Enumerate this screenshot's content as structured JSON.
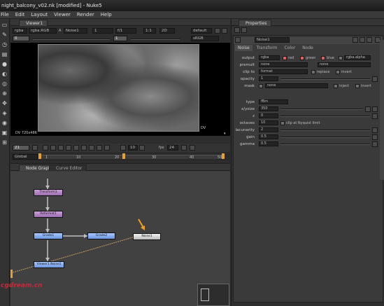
{
  "window": {
    "title": "night_balcony_v02.nk [modified] - Nuke5"
  },
  "menu": [
    "File",
    "Edit",
    "Layout",
    "Viewer",
    "Render",
    "Help"
  ],
  "viewer": {
    "tab_label": "Viewer1",
    "channels": "rgba",
    "channel_set": "rgba.RGB",
    "alpha_label": "A",
    "alpha_value": "Noise1",
    "gain_value": "1",
    "gain_label": "f/1",
    "gamma_value": "1",
    "zoom": "1:1",
    "view_mode": "2D",
    "lut": "default",
    "exposure_value": "0",
    "color_space": "sRGB",
    "y_value": "1",
    "format_label": "DV 720x486",
    "format_corner": "DV",
    "frame": "21",
    "fps_label": "fps",
    "fps_value": "24",
    "playback_skip": "10",
    "timeline_range": "Global",
    "timeline_ticks": [
      "1",
      "10",
      "20",
      "30",
      "40",
      "50"
    ]
  },
  "node_graph": {
    "tabs": [
      "Node Graph",
      "Curve Editor"
    ],
    "nodes": {
      "transform": "Transform1",
      "reformat": "Reformat1",
      "grade1": "Grade1",
      "grade2": "Grade2",
      "noise": "Noise1",
      "merge": "Viewer1 Noise1"
    },
    "watermark": "cgdream.cn"
  },
  "properties": {
    "tab_label": "Properties",
    "node_name": "Noise1",
    "tabs": [
      "Noise",
      "Transform",
      "Color",
      "Node"
    ],
    "output_label": "output",
    "output_value": "rgba",
    "channels_checks": [
      "red",
      "green",
      "blue"
    ],
    "alpha_value": "rgba.alpha",
    "premult_label": "premult",
    "premult_value": "none",
    "premult_value2": "none",
    "clip_label": "clip to",
    "clip_value": "format",
    "replace_label": "replace",
    "invert_label": "invert",
    "opacity_label": "opacity",
    "opacity_value": "1",
    "mask_label": "mask",
    "mask_value": "none",
    "inject_label": "inject",
    "invert2_label": "invert",
    "type_label": "type",
    "type_value": "fBm",
    "xsize_label": "x/ysize",
    "xsize_value": "350",
    "z_label": "z",
    "z_value": "0",
    "octaves_label": "octaves",
    "octaves_value": "10",
    "nyquist_label": "clip at Nyquist limit",
    "lacunarity_label": "lacunarity",
    "lacunarity_value": "2",
    "gain_label": "gain",
    "gain_value": "0.5",
    "gamma_label": "gamma",
    "gamma_value": "0.5"
  },
  "colors": {
    "accent": "#e06060",
    "node_purple": "#b58ac8",
    "node_blue": "#8ab0f0"
  }
}
